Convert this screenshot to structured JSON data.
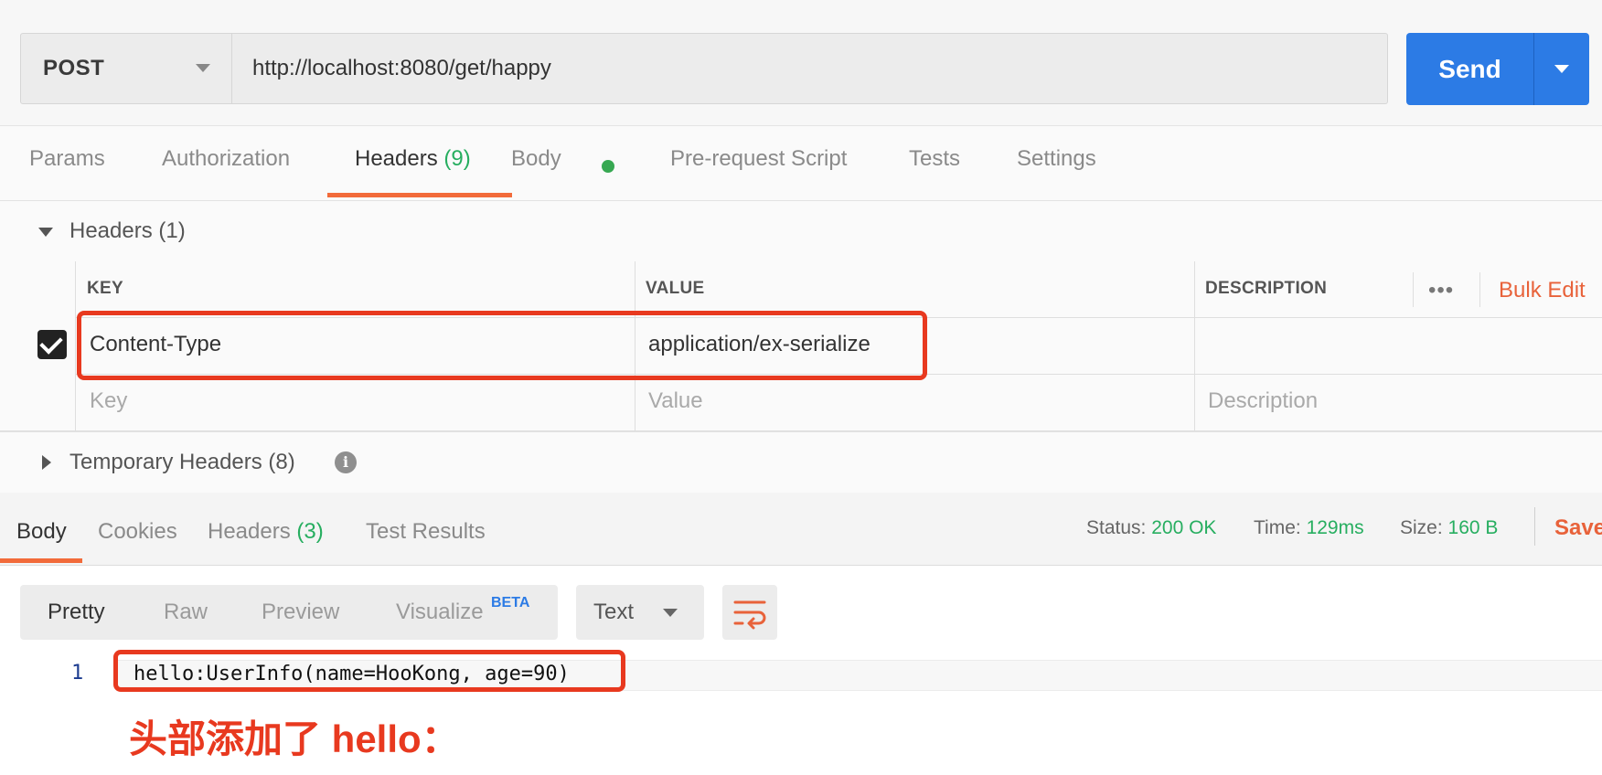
{
  "request": {
    "method": "POST",
    "url": "http://localhost:8080/get/happy",
    "send_label": "Send"
  },
  "request_tabs": {
    "params": "Params",
    "authorization": "Authorization",
    "headers": "Headers",
    "headers_count": "(9)",
    "body": "Body",
    "prerequest": "Pre-request Script",
    "tests": "Tests",
    "settings": "Settings"
  },
  "headers_section": {
    "title": "Headers",
    "count": "(1)",
    "columns": {
      "key": "KEY",
      "value": "VALUE",
      "description": "DESCRIPTION"
    },
    "more": "•••",
    "bulk_edit": "Bulk Edit",
    "rows": [
      {
        "key": "Content-Type",
        "value": "application/ex-serialize",
        "description": ""
      }
    ],
    "placeholders": {
      "key": "Key",
      "value": "Value",
      "description": "Description"
    }
  },
  "temporary_headers": {
    "title": "Temporary Headers",
    "count": "(8)",
    "info": "i"
  },
  "response_tabs": {
    "body": "Body",
    "cookies": "Cookies",
    "headers": "Headers",
    "headers_count": "(3)",
    "test_results": "Test Results"
  },
  "response_meta": {
    "status_label": "Status:",
    "status_value": "200 OK",
    "time_label": "Time:",
    "time_value": "129ms",
    "size_label": "Size:",
    "size_value": "160 B",
    "save": "Save"
  },
  "view_modes": {
    "pretty": "Pretty",
    "raw": "Raw",
    "preview": "Preview",
    "visualize": "Visualize",
    "beta": "BETA"
  },
  "format": "Text",
  "editor": {
    "line_number": "1",
    "line_text": "hello:UserInfo(name=HooKong, age=90)"
  },
  "annotation": "头部添加了 hello：",
  "colors": {
    "accent_blue": "#2c7be5",
    "accent_orange": "#f26b3a",
    "status_green": "#27ae60",
    "annotation_red": "#e8391f"
  }
}
